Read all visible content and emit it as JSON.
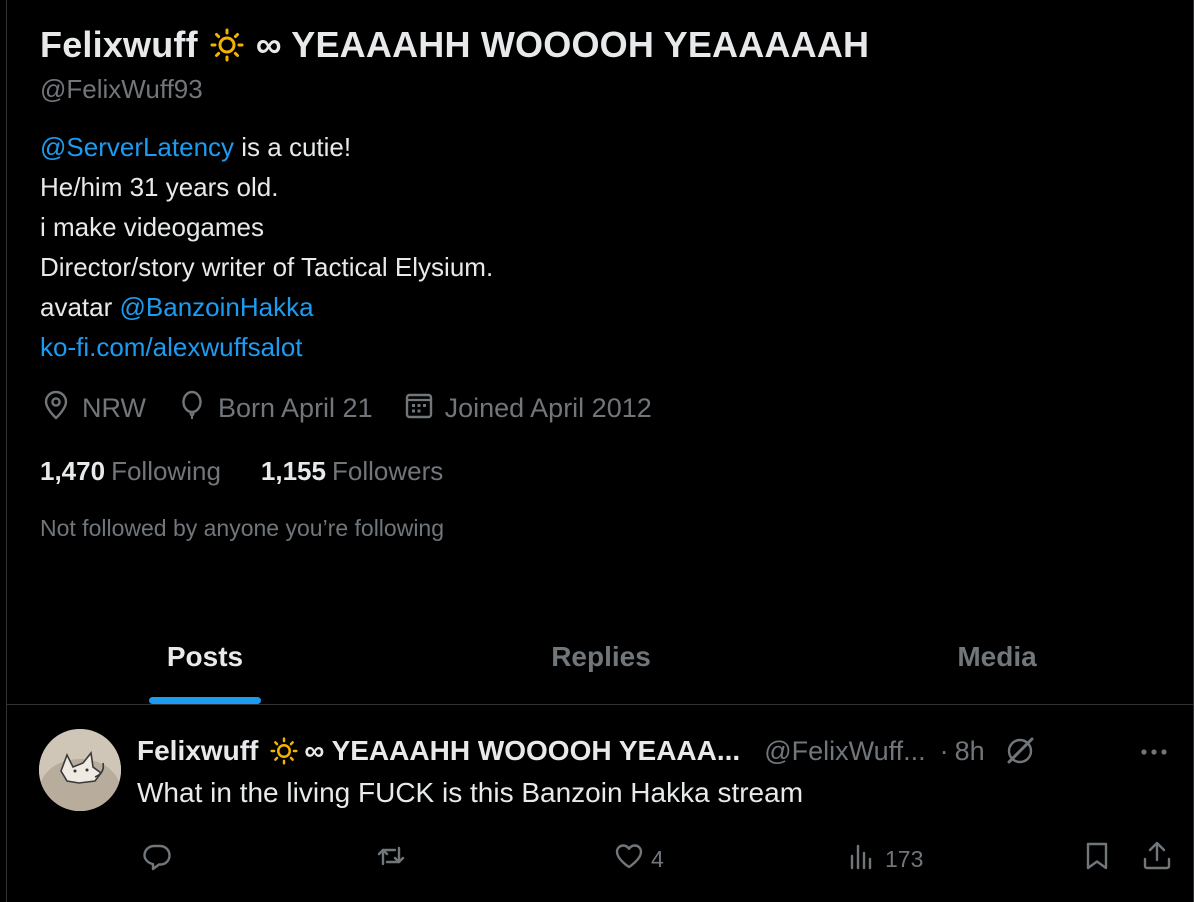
{
  "profile": {
    "display_name": "Felixwuff",
    "name_title": "YEAAAHH WOOOOH YEAAAAAH",
    "infinity_glyph": "∞",
    "handle": "@FelixWuff93",
    "bio": {
      "mention1": "@ServerLatency",
      "line1_rest": " is a cutie!",
      "line2": "He/him 31 years old.",
      "line3": "i make videogames",
      "line4": "Director/story writer of Tactical Elysium.",
      "line5_prefix": "avatar ",
      "mention2": "@BanzoinHakka",
      "link": "ko-fi.com/alexwuffsalot"
    },
    "location": "NRW",
    "birthday": "Born April 21",
    "joined": "Joined April 2012",
    "following_count": "1,470",
    "following_label": "Following",
    "followers_count": "1,155",
    "followers_label": "Followers",
    "not_followed": "Not followed by anyone you’re following"
  },
  "tabs": [
    {
      "label": "Posts",
      "active": true
    },
    {
      "label": "Replies",
      "active": false
    },
    {
      "label": "Media",
      "active": false
    }
  ],
  "post": {
    "name": "Felixwuff",
    "title": "∞ YEAAAHH WOOOOH YEAAA...",
    "handle": "@FelixWuff...",
    "dot": "·",
    "time": "8h",
    "text": "What in the living FUCK is this Banzoin Hakka stream",
    "likes": "4",
    "views": "173"
  },
  "colors": {
    "accent": "#1d9bf0",
    "muted": "#71767b",
    "text": "#e7e9ea",
    "background": "#000000",
    "sun": "#f5b301"
  },
  "icons": [
    "sun-icon",
    "location-icon",
    "balloon-icon",
    "calendar-icon",
    "reply-icon",
    "repost-icon",
    "like-icon",
    "views-icon",
    "bookmark-icon",
    "share-icon",
    "grok-icon",
    "more-icon"
  ]
}
